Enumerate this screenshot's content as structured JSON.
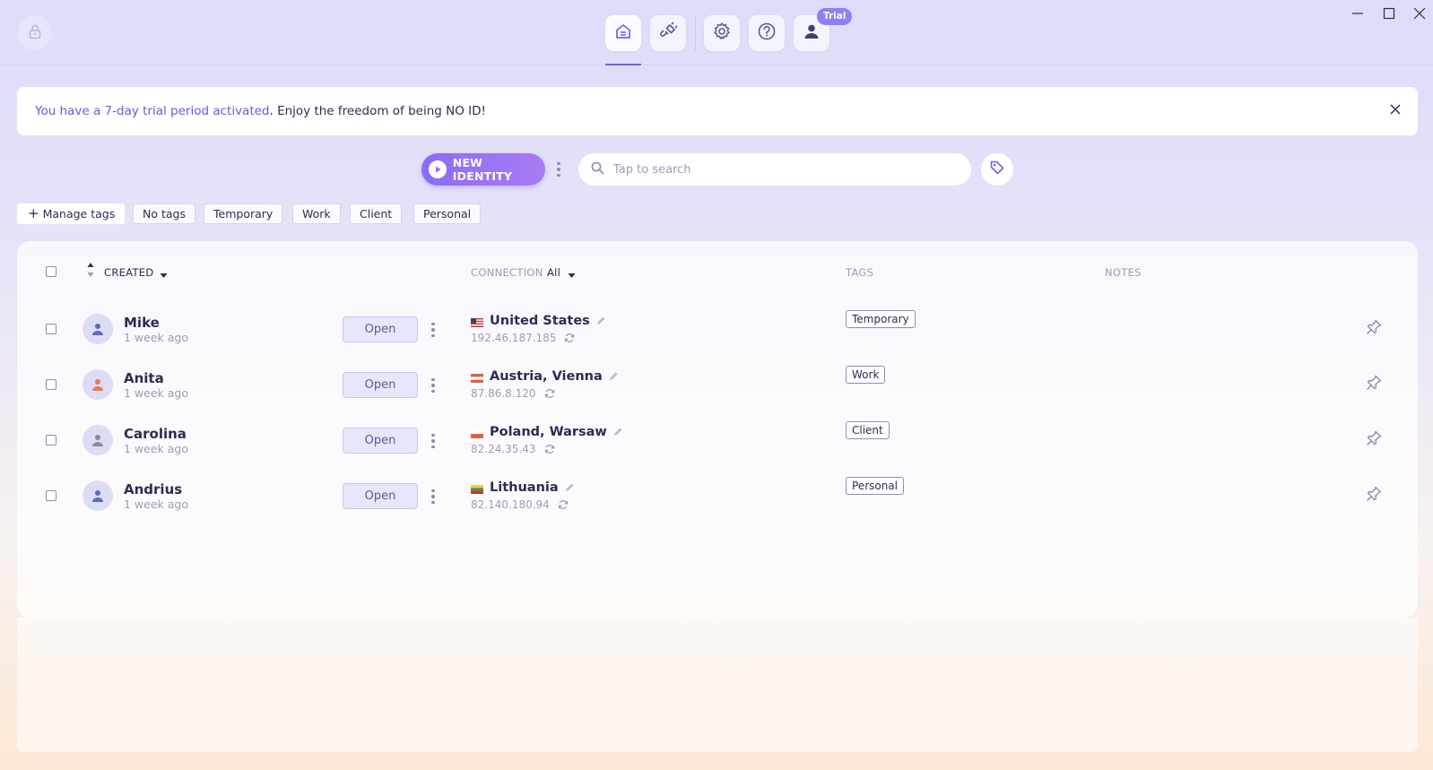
{
  "header": {
    "trial_badge": "Trial",
    "nav": [
      {
        "name": "home",
        "icon": "home-icon"
      },
      {
        "name": "connections",
        "icon": "plug-icon"
      },
      {
        "name": "settings",
        "icon": "gear-icon"
      },
      {
        "name": "help",
        "icon": "help-icon"
      },
      {
        "name": "account",
        "icon": "user-icon"
      }
    ]
  },
  "banner": {
    "highlight": "You have a 7-day trial period activated",
    "text": ". Enjoy the freedom of being NO ID!"
  },
  "toolbar": {
    "new_identity_label": "NEW IDENTITY",
    "search_placeholder": "Tap to search"
  },
  "tags_filter": {
    "manage_label": "Manage tags",
    "tags": [
      "No tags",
      "Temporary",
      "Work",
      "Client",
      "Personal"
    ]
  },
  "table": {
    "columns": {
      "created": "CREATED",
      "connection": "CONNECTION",
      "connection_filter": "All",
      "tags": "TAGS",
      "notes": "NOTES"
    },
    "open_label": "Open",
    "rows": [
      {
        "name": "Mike",
        "created": "1 week ago",
        "location": "United States",
        "ip": "192.46.187.185",
        "tag": "Temporary",
        "avatar_color": "#5c6ab8"
      },
      {
        "name": "Anita",
        "created": "1 week ago",
        "location": "Austria, Vienna",
        "ip": "87.86.8.120",
        "tag": "Work",
        "avatar_color": "#e27d56"
      },
      {
        "name": "Carolina",
        "created": "1 week ago",
        "location": "Poland, Warsaw",
        "ip": "82.24.35.43",
        "tag": "Client",
        "avatar_color": "#8a8aa0"
      },
      {
        "name": "Andrius",
        "created": "1 week ago",
        "location": "Lithuania",
        "ip": "82.140.180.94",
        "tag": "Personal",
        "avatar_color": "#5c6ab8"
      }
    ]
  },
  "colors": {
    "accent": "#7c5cf0",
    "text": "#2b2d52",
    "muted": "#9a9cba"
  }
}
